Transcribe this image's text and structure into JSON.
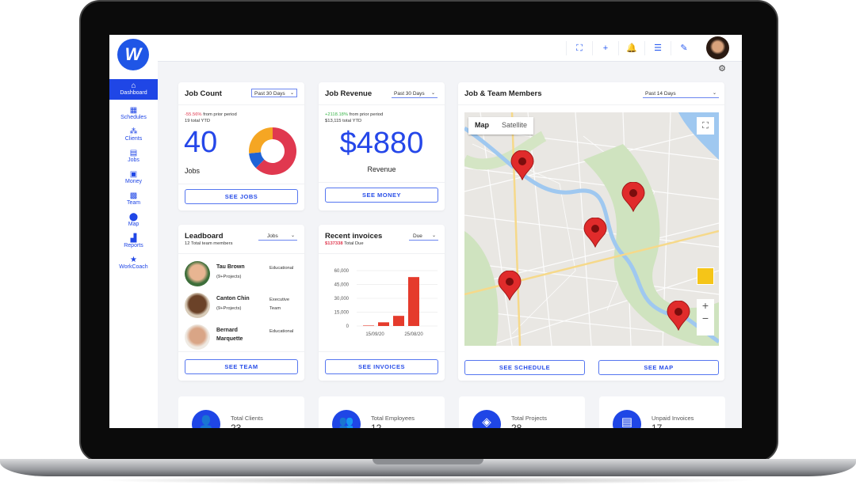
{
  "sidebar": {
    "logo_letter": "W",
    "items": [
      {
        "label": "Dashboard",
        "icon": "home-icon",
        "glyph": "⌂",
        "active": true
      },
      {
        "label": "Schedules",
        "icon": "calendar-icon",
        "glyph": "▦"
      },
      {
        "label": "Clients",
        "icon": "clients-icon",
        "glyph": "⁂"
      },
      {
        "label": "Jobs",
        "icon": "jobs-icon",
        "glyph": "▤"
      },
      {
        "label": "Money",
        "icon": "money-icon",
        "glyph": "▣"
      },
      {
        "label": "Team",
        "icon": "team-icon",
        "glyph": "▩"
      },
      {
        "label": "Map",
        "icon": "map-pin-icon",
        "glyph": "⬤"
      },
      {
        "label": "Reports",
        "icon": "reports-icon",
        "glyph": "▟"
      },
      {
        "label": "WorkCoach",
        "icon": "star-icon",
        "glyph": "★"
      }
    ]
  },
  "topbar": {
    "icons": [
      {
        "name": "fullscreen-icon",
        "glyph": "⛶"
      },
      {
        "name": "plus-icon",
        "glyph": "+"
      },
      {
        "name": "bell-icon",
        "glyph": "🔔"
      },
      {
        "name": "list-icon",
        "glyph": "☰"
      },
      {
        "name": "edit-icon",
        "glyph": "✎"
      }
    ],
    "settings_glyph": "⚙"
  },
  "job_count": {
    "title": "Job Count",
    "period": "Past 30 Days",
    "change": "-55.56%",
    "change_text": "from prior period",
    "ytd": "19 total YTD",
    "value": "40",
    "unit": "Jobs",
    "button": "SEE JOBS",
    "donut": [
      {
        "share": 0.625,
        "color": "#e0384f"
      },
      {
        "share": 0.11,
        "color": "#1f63d6"
      },
      {
        "share": 0.265,
        "color": "#f5a623"
      }
    ]
  },
  "job_revenue": {
    "title": "Job Revenue",
    "period": "Past 30 Days",
    "change": "+2118.18%",
    "change_text": "from prior period",
    "ytd": "$13,115 total YTD",
    "value": "$4880",
    "unit": "Revenue",
    "button": "SEE MONEY"
  },
  "map_card": {
    "title": "Job & Team Members",
    "period": "Past 14 Days",
    "map_tab": "Map",
    "satellite_tab": "Satellite",
    "zoom_in": "+",
    "zoom_out": "−",
    "button_schedule": "SEE SCHEDULE",
    "button_map": "SEE MAP"
  },
  "leadboard": {
    "title": "Leadboard",
    "filter": "Jobs",
    "subtitle": "12 Total team members",
    "button": "SEE TEAM",
    "members": [
      {
        "name": "Tau Brown",
        "projects": "(9+Projects)",
        "role": "Educational"
      },
      {
        "name": "Canton Chin",
        "projects": "(9+Projects)",
        "role": "Executive Team"
      },
      {
        "name": "Bernard Marquette",
        "projects": "",
        "role": "Educational"
      }
    ]
  },
  "invoices": {
    "title": "Recent invoices",
    "filter": "Due",
    "total": "$137338",
    "total_text": "Total Due",
    "button": "SEE INVOICES"
  },
  "chart_data": {
    "type": "bar",
    "categories": [
      "15/09/20",
      "",
      "",
      "25/08/20"
    ],
    "values": [
      500,
      4000,
      11000,
      53000
    ],
    "ylim": [
      0,
      60000
    ],
    "yticks": [
      "60,000",
      "45,000",
      "30,000",
      "15,000",
      "0"
    ],
    "ytick_values": [
      60000,
      45000,
      30000,
      15000,
      0
    ],
    "color": "#e53b2c",
    "grid": true
  },
  "stats": [
    {
      "label": "Total Clients",
      "value": "23",
      "icon": "user-icon",
      "glyph": "👤"
    },
    {
      "label": "Total Employees",
      "value": "12",
      "icon": "users-icon",
      "glyph": "👥"
    },
    {
      "label": "Total Projects",
      "value": "28",
      "icon": "layers-icon",
      "glyph": "◈"
    },
    {
      "label": "Unpaid Invoices",
      "value": "17",
      "icon": "document-icon",
      "glyph": "▤"
    }
  ],
  "colors": {
    "accent": "#1f46e6",
    "negative": "#e0384f",
    "positive": "#3ab54a"
  }
}
